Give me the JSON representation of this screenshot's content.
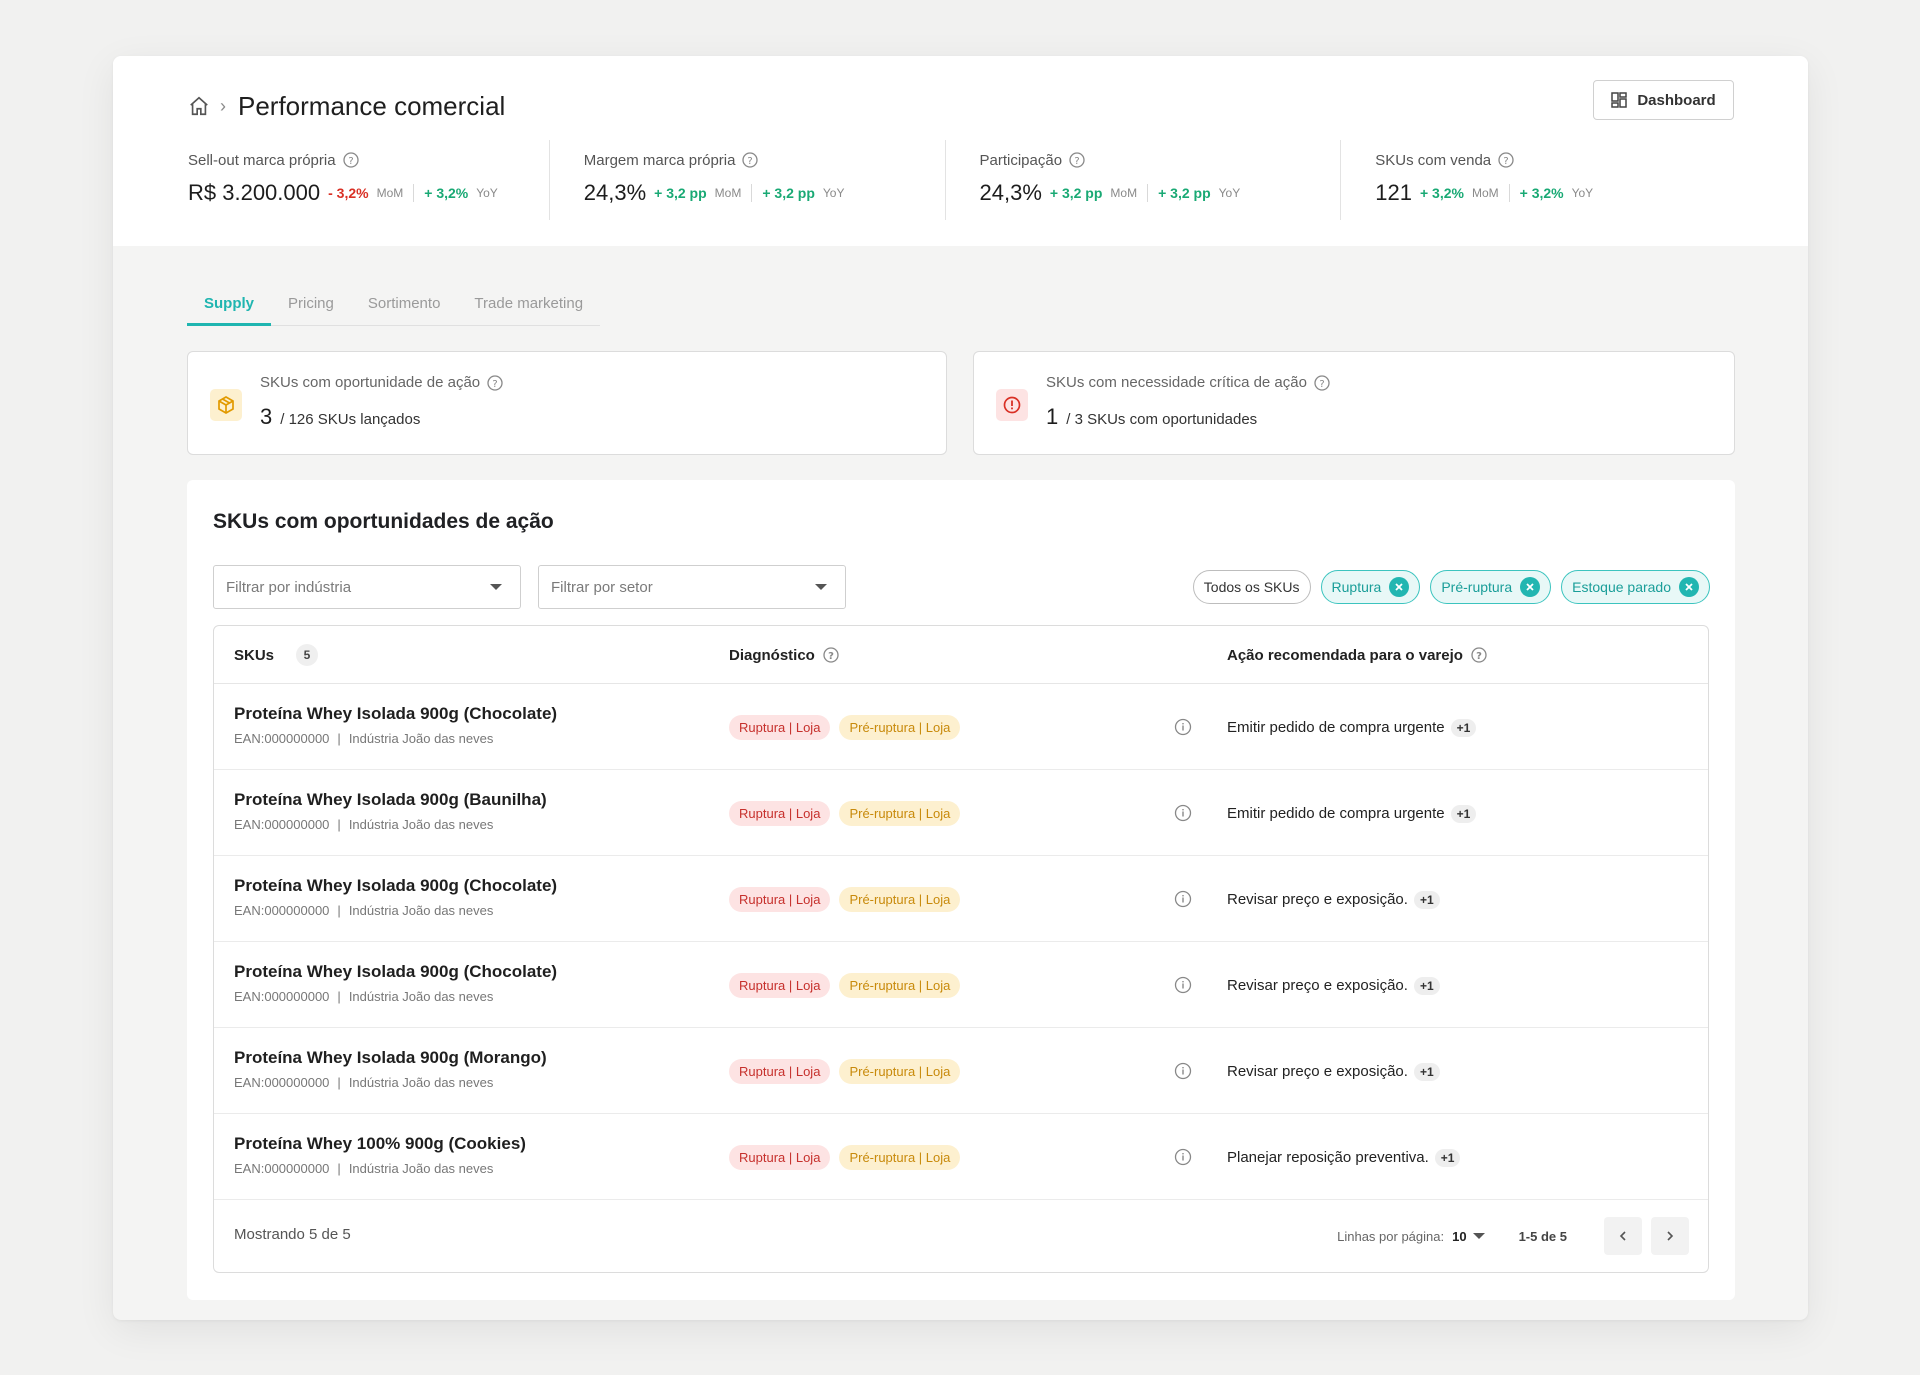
{
  "header": {
    "title": "Performance comercial",
    "dashboard_label": "Dashboard"
  },
  "kpis": [
    {
      "label": "Sell-out marca própria",
      "value": "R$ 3.200.000",
      "mom": "- 3,2%",
      "mom_unit": "MoM",
      "yoy": "+ 3,2%",
      "yoy_unit": "YoY"
    },
    {
      "label": "Margem marca própria",
      "value": "24,3%",
      "mom": "+ 3,2 pp",
      "mom_unit": "MoM",
      "yoy": "+ 3,2 pp",
      "yoy_unit": "YoY"
    },
    {
      "label": "Participação",
      "value": "24,3%",
      "mom": "+ 3,2 pp",
      "mom_unit": "MoM",
      "yoy": "+ 3,2 pp",
      "yoy_unit": "YoY"
    },
    {
      "label": "SKUs com venda",
      "value": "121",
      "mom": "+ 3,2%",
      "mom_unit": "MoM",
      "yoy": "+ 3,2%",
      "yoy_unit": "YoY"
    }
  ],
  "tabs": [
    "Supply",
    "Pricing",
    "Sortimento",
    "Trade marketing"
  ],
  "cards": [
    {
      "title": "SKUs com oportunidade de ação",
      "value": "3",
      "suffix": "/ 126 SKUs lançados"
    },
    {
      "title": "SKUs com necessidade crítica de ação",
      "value": "1",
      "suffix": "/ 3 SKUs com oportunidades"
    }
  ],
  "panel": {
    "title": "SKUs com oportunidades de ação",
    "filter_industry_placeholder": "Filtrar por indústria",
    "filter_sector_placeholder": "Filtrar por setor",
    "chips": {
      "all": "Todos os SKUs",
      "ruptura": "Ruptura",
      "pre_ruptura": "Pré-ruptura",
      "estoque": "Estoque parado"
    },
    "columns": {
      "skus": "SKUs",
      "skus_count": "5",
      "diagnostico": "Diagnóstico",
      "acao": "Ação recomendada para o varejo"
    },
    "rows": [
      {
        "name": "Proteína Whey Isolada 900g (Chocolate)",
        "ean": "EAN:000000000",
        "industry": "Indústria João das neves",
        "tag1": "Ruptura | Loja",
        "tag2": "Pré-ruptura | Loja",
        "action": "Emitir pedido de compra urgente",
        "more": "+1"
      },
      {
        "name": "Proteína Whey Isolada 900g (Baunilha)",
        "ean": "EAN:000000000",
        "industry": "Indústria João das neves",
        "tag1": "Ruptura | Loja",
        "tag2": "Pré-ruptura | Loja",
        "action": "Emitir pedido de compra urgente",
        "more": "+1"
      },
      {
        "name": "Proteína Whey Isolada 900g (Chocolate)",
        "ean": "EAN:000000000",
        "industry": "Indústria João das neves",
        "tag1": "Ruptura | Loja",
        "tag2": "Pré-ruptura | Loja",
        "action": "Revisar preço e exposição.",
        "more": "+1"
      },
      {
        "name": "Proteína Whey Isolada 900g (Chocolate)",
        "ean": "EAN:000000000",
        "industry": "Indústria João das neves",
        "tag1": "Ruptura | Loja",
        "tag2": "Pré-ruptura | Loja",
        "action": "Revisar preço e exposição.",
        "more": "+1"
      },
      {
        "name": "Proteína Whey Isolada 900g (Morango)",
        "ean": "EAN:000000000",
        "industry": "Indústria João das neves",
        "tag1": "Ruptura | Loja",
        "tag2": "Pré-ruptura | Loja",
        "action": "Revisar preço e exposição.",
        "more": "+1"
      },
      {
        "name": "Proteína Whey 100% 900g (Cookies)",
        "ean": "EAN:000000000",
        "industry": "Indústria João das neves",
        "tag1": "Ruptura | Loja",
        "tag2": "Pré-ruptura | Loja",
        "action": "Planejar reposição preventiva.",
        "more": "+1"
      }
    ],
    "footer": {
      "showing": "Mostrando 5 de 5",
      "rows_per_page_label": "Linhas por página:",
      "rows_per_page": "10",
      "range": "1-5 de 5"
    }
  },
  "colors": {
    "accent": "#1fb5b0",
    "negative": "#d93025",
    "positive": "#19a974",
    "tag_red_bg": "#fde3e3",
    "tag_yellow_bg": "#fdf0cf"
  }
}
